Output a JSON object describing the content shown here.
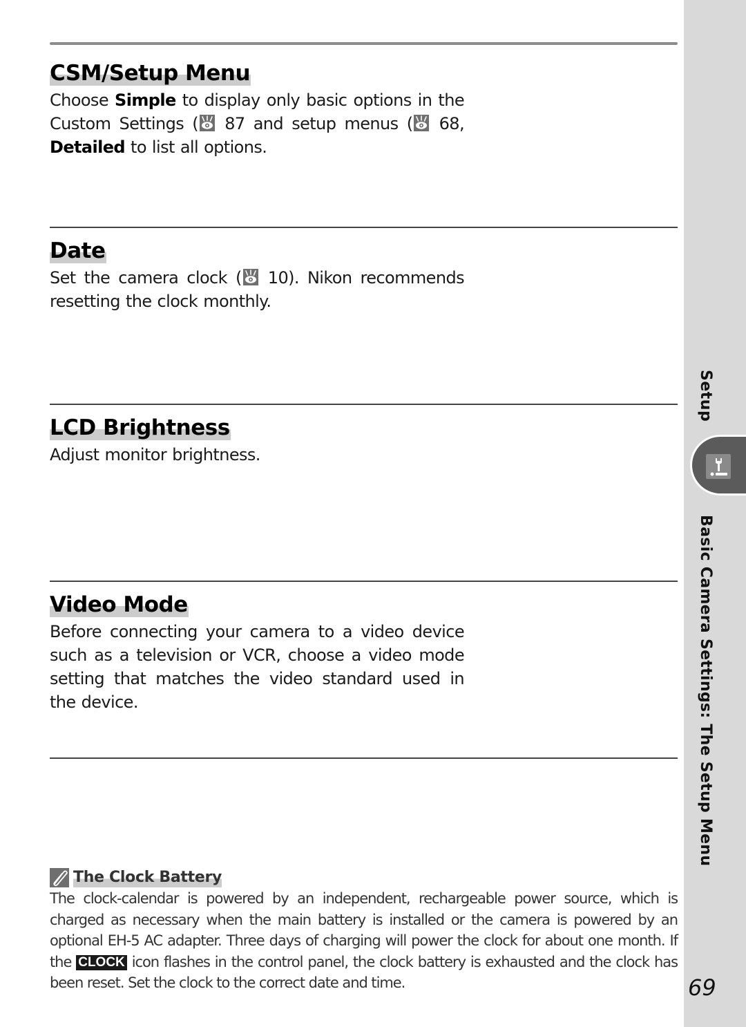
{
  "page": {
    "page_number": "69",
    "sidebar": {
      "section_label": "Setup",
      "chapter_label": "Basic Camera Settings: The Setup Menu",
      "tab_icon": "wrench-setup-icon"
    }
  },
  "sections": [
    {
      "title": "CSM/Setup Menu",
      "body": [
        {
          "t": "text",
          "v": "Choose "
        },
        {
          "t": "bold",
          "v": "Simple"
        },
        {
          "t": "text",
          "v": " to display only basic options in the Custom Settings ("
        },
        {
          "t": "ref",
          "v": "87"
        },
        {
          "t": "text",
          "v": " and setup menus ("
        },
        {
          "t": "ref",
          "v": "68"
        },
        {
          "t": "text",
          "v": ", "
        },
        {
          "t": "bold",
          "v": "Detailed"
        },
        {
          "t": "text",
          "v": " to list all options."
        }
      ]
    },
    {
      "title": "Date",
      "body": [
        {
          "t": "text",
          "v": "Set the camera clock ("
        },
        {
          "t": "ref",
          "v": "10"
        },
        {
          "t": "text",
          "v": ").  Nikon recommends resetting the clock monthly."
        }
      ]
    },
    {
      "title": "LCD Brightness",
      "body": [
        {
          "t": "text",
          "v": "Adjust monitor brightness."
        }
      ]
    },
    {
      "title": "Video Mode",
      "body": [
        {
          "t": "text",
          "v": "Before connecting your camera to a video device such as a television or VCR, choose a video mode setting that matches the video standard used in the device."
        }
      ]
    }
  ],
  "note": {
    "icon": "pencil-note-icon",
    "title": "The Clock Battery",
    "body_before_badge": "The clock-calendar is powered by an independent, rechargeable power source, which is charged as necessary when the main battery is installed or the camera is powered by an optional EH-5 AC adapter.  Three days of charging will power the clock for about one month.  If the ",
    "badge": "CLOCK",
    "body_after_badge": " icon flashes in the control panel, the clock battery is exhausted and the clock has been reset.  Set the clock to the correct date and time."
  },
  "colors": {
    "sidebar_bg": "#d9d9d9",
    "tab_bg": "#5b5b5b",
    "heading_highlight": "#cccccc",
    "icon_gray": "#6f6f6f"
  }
}
